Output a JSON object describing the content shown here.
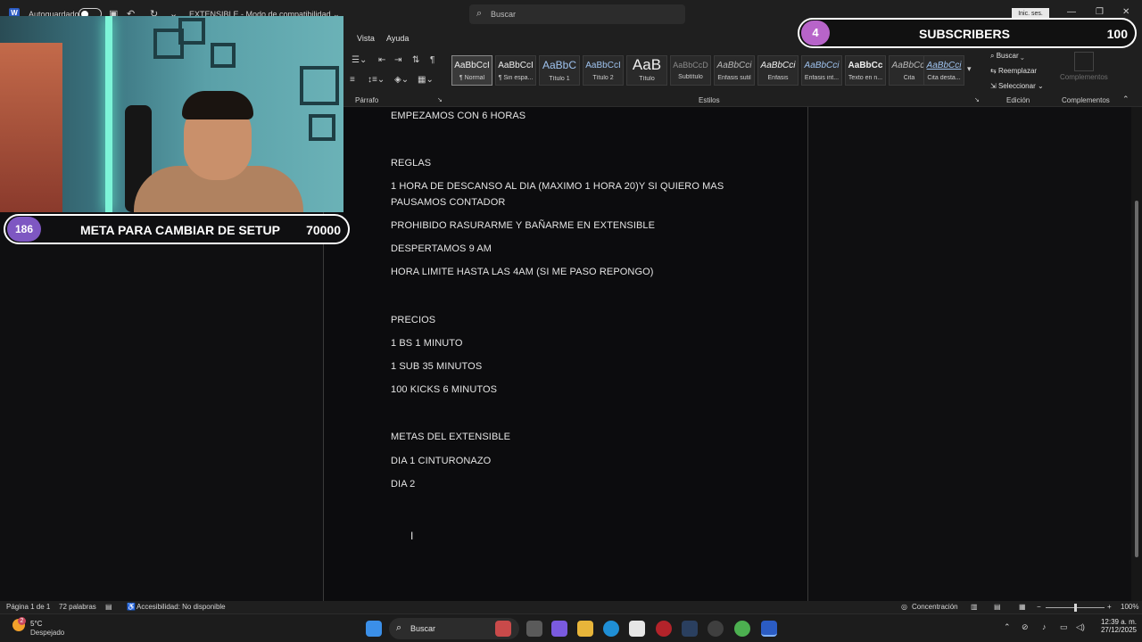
{
  "titlebar": {
    "autosave_label": "Autoguardado",
    "doc_title": "EXTENSIBLE - Modo de compatibilidad ⌄",
    "search_placeholder": "Buscar",
    "signin_label": "Inic. ses."
  },
  "menu": {
    "vista": "Vista",
    "ayuda": "Ayuda"
  },
  "ribbon": {
    "paragraph_group": "Párrafo",
    "styles_group": "Estilos",
    "editing_group": "Edición",
    "addins_group": "Complementos",
    "addins_button": "Complementos",
    "styles": [
      {
        "sample": "AaBbCcI",
        "name": "¶ Normal"
      },
      {
        "sample": "AaBbCcI",
        "name": "¶ Sin espa..."
      },
      {
        "sample": "AaBbC",
        "name": "Título 1"
      },
      {
        "sample": "AaBbCcI",
        "name": "Título 2"
      },
      {
        "sample": "AaB",
        "name": "Título"
      },
      {
        "sample": "AaBbCcD",
        "name": "Subtítulo"
      },
      {
        "sample": "AaBbCci",
        "name": "Énfasis sutil"
      },
      {
        "sample": "AaBbCci",
        "name": "Énfasis"
      },
      {
        "sample": "AaBbCci",
        "name": "Énfasis int..."
      },
      {
        "sample": "AaBbCc",
        "name": "Texto en n..."
      },
      {
        "sample": "AaBbCci",
        "name": "Cita"
      },
      {
        "sample": "AaBbCci",
        "name": "Cita desta..."
      }
    ],
    "edit_find": "Buscar",
    "edit_replace": "Reemplazar",
    "edit_select": "Seleccionar"
  },
  "document": {
    "lines": [
      "EMPEZAMOS CON 6 HORAS",
      "REGLAS",
      "1 HORA DE DESCANSO AL DIA (MAXIMO 1 HORA 20)Y SI QUIERO MAS",
      "PAUSAMOS CONTADOR",
      "PROHIBIDO RASURARME Y BAÑARME EN EXTENSIBLE",
      "DESPERTAMOS 9 AM",
      "HORA LIMITE HASTA LAS 4AM (SI ME PASO REPONGO)",
      "PRECIOS",
      "1 BS 1 MINUTO",
      "1 SUB 35 MINUTOS",
      "100 KICKS 6 MINUTOS",
      "METAS DEL EXTENSIBLE",
      "DIA 1 CINTURONAZO",
      "DIA 2"
    ]
  },
  "statusbar": {
    "page": "Página 1 de 1",
    "words": "72 palabras",
    "accessibility": "Accesibilidad: No disponible",
    "focus": "Concentración",
    "zoom": "100%"
  },
  "taskbar": {
    "temp": "5°C",
    "weather": "Despejado",
    "weather_badge": "2",
    "search": "Buscar",
    "time": "12:39 a. m.",
    "date": "27/12/2025"
  },
  "overlays": {
    "goal_current": "186",
    "goal_label": "META PARA CAMBIAR DE SETUP",
    "goal_target": "70000",
    "subs_current": "4",
    "subs_label": "SUBSCRIBERS",
    "subs_target": "100"
  },
  "colors": {
    "goal_pill": "#7e57c2",
    "subs_pill": "#b764c9",
    "word_blue": "#2b5cc4"
  }
}
